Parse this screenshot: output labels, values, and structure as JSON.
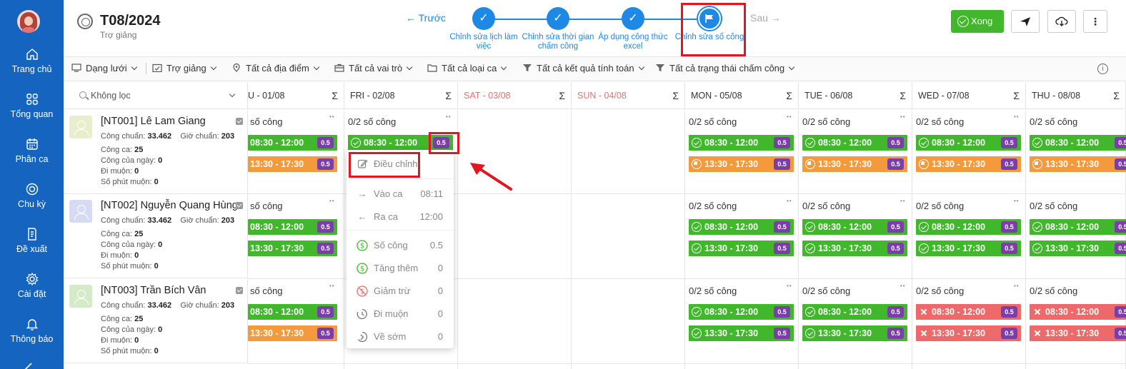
{
  "sidebar": {
    "items": [
      {
        "label": "Trang chủ",
        "icon": "home-icon"
      },
      {
        "label": "Tổng quan",
        "icon": "grid-icon"
      },
      {
        "label": "Phân ca",
        "icon": "calendar-icon"
      },
      {
        "label": "Chu kỳ",
        "icon": "cycle-icon"
      },
      {
        "label": "Đề xuất",
        "icon": "document-icon"
      },
      {
        "label": "Cài đặt",
        "icon": "gear-icon"
      },
      {
        "label": "Thông báo",
        "icon": "bell-icon"
      }
    ]
  },
  "header": {
    "title": "T08/2024",
    "subtitle": "Trợ giảng",
    "prev_label": "← Trước",
    "next_label": "Sau →",
    "steps": [
      {
        "label": "Chỉnh sửa lịch làm việc",
        "icon": "check-icon"
      },
      {
        "label": "Chỉnh sửa thời gian chấm công",
        "icon": "check-icon"
      },
      {
        "label": "Áp dụng công thức excel",
        "icon": "check-icon"
      },
      {
        "label": "Chỉnh sửa số công",
        "icon": "flag-icon"
      }
    ],
    "done_label": "Xong"
  },
  "toolbar": {
    "items": [
      {
        "label": "Dạng lưới",
        "icon": "monitor-icon"
      },
      {
        "label": "Trợ giảng",
        "icon": "calendar-check-icon"
      },
      {
        "label": "Tất cả địa điểm",
        "icon": "location-icon"
      },
      {
        "label": "Tất cả vai trò",
        "icon": "briefcase-icon"
      },
      {
        "label": "Tất cả loại ca",
        "icon": "folder-icon"
      },
      {
        "label": "Tất cả kết quả tính toán",
        "icon": "filter-icon"
      },
      {
        "label": "Tất cả trạng thái chấm công",
        "icon": "filter-icon"
      }
    ]
  },
  "filter": {
    "label": "Không lọc"
  },
  "columns": [
    {
      "label": "U - 01/08",
      "weekend": false
    },
    {
      "label": "FRI - 02/08",
      "weekend": false
    },
    {
      "label": "SAT - 03/08",
      "weekend": true
    },
    {
      "label": "SUN - 04/08",
      "weekend": true
    },
    {
      "label": "MON - 05/08",
      "weekend": false
    },
    {
      "label": "TUE - 06/08",
      "weekend": false
    },
    {
      "label": "WED - 07/08",
      "weekend": false
    },
    {
      "label": "THU - 08/08",
      "weekend": false
    }
  ],
  "employees": [
    {
      "name": "[NT001] Lê Lam Giang",
      "cong_chuan_label": "Công chuẩn:",
      "cong_chuan": "33.462",
      "gio_chuan_label": "Giờ chuẩn:",
      "gio_chuan": "203",
      "cong_ca_label": "Công ca:",
      "cong_ca": "25",
      "cong_ngay_label": "Công của ngày:",
      "cong_ngay": "0",
      "di_muon_label": "Đi muộn:",
      "di_muon": "0",
      "phut_muon_label": "Số phút muộn:",
      "phut_muon": "0",
      "avatar_color": "#e8edcc"
    },
    {
      "name": "[NT002] Nguyễn Quang Hùng",
      "cong_chuan_label": "Công chuẩn:",
      "cong_chuan": "33.462",
      "gio_chuan_label": "Giờ chuẩn:",
      "gio_chuan": "203",
      "cong_ca_label": "Công ca:",
      "cong_ca": "25",
      "cong_ngay_label": "Công của ngày:",
      "cong_ngay": "0",
      "di_muon_label": "Đi muộn:",
      "di_muon": "0",
      "phut_muon_label": "Số phút muộn:",
      "phut_muon": "0",
      "avatar_color": "#d6dbf5"
    },
    {
      "name": "[NT003] Trần Bích Vân",
      "cong_chuan_label": "Công chuẩn:",
      "cong_chuan": "33.462",
      "gio_chuan_label": "Giờ chuẩn:",
      "gio_chuan": "203",
      "cong_ca_label": "Công ca:",
      "cong_ca": "25",
      "cong_ngay_label": "Công của ngày:",
      "cong_ngay": "0",
      "di_muon_label": "Đi muộn:",
      "di_muon": "0",
      "phut_muon_label": "Số phút muộn:",
      "phut_muon": "0",
      "avatar_color": "#d3ebc7"
    }
  ],
  "cells": {
    "header_full": "0/2 số công",
    "header_cut": "số công",
    "shift_morning": "08:30 - 12:00",
    "shift_afternoon": "13:30 - 17:30",
    "badge": "0.5"
  },
  "context_menu": {
    "edit": "Điều chỉnh",
    "check_in": {
      "label": "Vào ca",
      "value": "08:11"
    },
    "check_out": {
      "label": "Ra ca",
      "value": "12:00"
    },
    "so_cong": {
      "label": "Số công",
      "value": "0.5"
    },
    "tang_them": {
      "label": "Tăng thêm",
      "value": "0"
    },
    "giam_tru": {
      "label": "Giảm trừ",
      "value": "0"
    },
    "di_muon": {
      "label": "Đi muộn",
      "value": "0"
    },
    "ve_som": {
      "label": "Về sớm",
      "value": "0"
    }
  },
  "colors": {
    "primary": "#1565c0",
    "accent": "#1e88e5",
    "ok": "#41b82b",
    "warn": "#f59a3c",
    "bad": "#ee6a6a",
    "badge": "#7b3ea8",
    "highlight": "#e3151f"
  }
}
